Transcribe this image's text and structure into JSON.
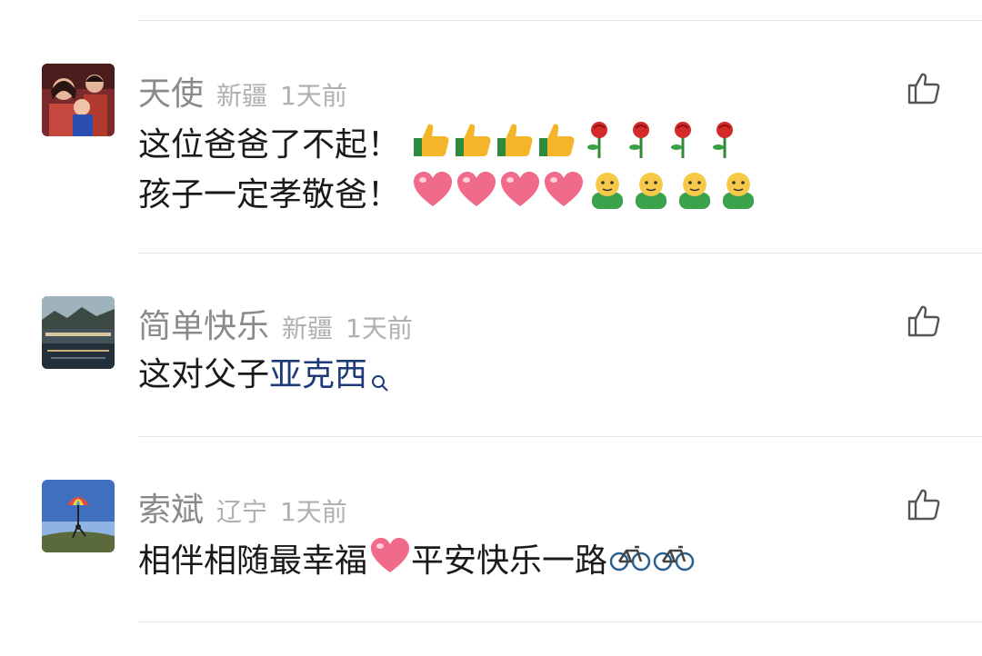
{
  "comments": [
    {
      "author": "天使",
      "location": "新疆",
      "time": "1天前",
      "line1": "这位爸爸了不起！",
      "line2": "孩子一定孝敬爸！",
      "emoji_line1": [
        "thumbs-up-icon",
        "thumbs-up-icon",
        "thumbs-up-icon",
        "thumbs-up-icon",
        "rose-icon",
        "rose-icon",
        "rose-icon",
        "rose-icon"
      ],
      "emoji_line2": [
        "heart-icon",
        "heart-icon",
        "heart-icon",
        "heart-icon",
        "smiley-icon",
        "smiley-icon",
        "smiley-icon",
        "smiley-icon"
      ]
    },
    {
      "author": "简单快乐",
      "location": "新疆",
      "time": "1天前",
      "text": "这对父子",
      "link": "亚克西"
    },
    {
      "author": "索斌",
      "location": "辽宁",
      "time": "1天前",
      "text_a": "相伴相随最幸福",
      "text_b": "平安快乐一路",
      "emojis": [
        "heart-icon",
        "bicycle-icon",
        "bicycle-icon"
      ]
    }
  ],
  "colors": {
    "name": "#8a8a8a",
    "meta": "#b0b0b0",
    "link": "#1f3a78",
    "divider": "#e8e8e8"
  }
}
